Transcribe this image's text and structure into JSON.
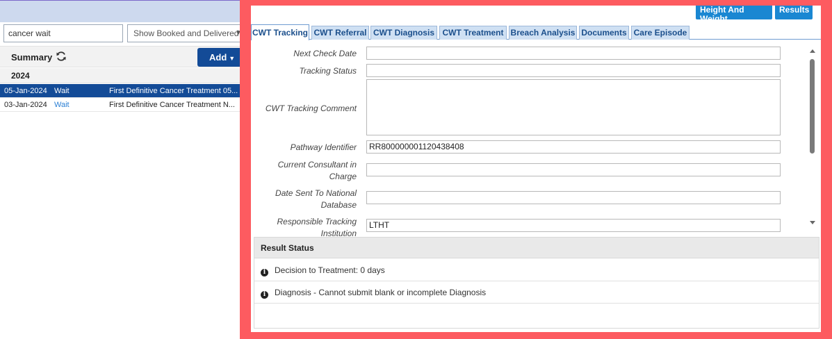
{
  "left_pane": {
    "search": {
      "value": "cancer wait"
    },
    "filter": {
      "value": "Show Booked and Delivered"
    },
    "summary_label": "Summary",
    "add_label": "Add",
    "year": "2024",
    "rows": [
      {
        "date": "05-Jan-2024",
        "type": "Wait",
        "description": "First Definitive Cancer Treatment 05...",
        "selected": true
      },
      {
        "date": "03-Jan-2024",
        "type": "Wait",
        "description": "First Definitive Cancer Treatment N...",
        "selected": false
      }
    ]
  },
  "modal": {
    "top_buttons": {
      "height_weight": "Height And Weight",
      "results": "Results"
    },
    "tabs": [
      "CWT Tracking",
      "CWT Referral",
      "CWT Diagnosis",
      "CWT Treatment",
      "Breach Analysis",
      "Documents",
      "Care Episode"
    ],
    "active_tab": "CWT Tracking",
    "fields": {
      "next_check_date": {
        "label": "Next Check Date",
        "value": ""
      },
      "tracking_status": {
        "label": "Tracking Status",
        "value": ""
      },
      "tracking_comment": {
        "label": "CWT Tracking Comment",
        "value": ""
      },
      "pathway_identifier": {
        "label": "Pathway Identifier",
        "value": "RR800000001120438408"
      },
      "current_consultant_1": "Current Consultant in",
      "current_consultant_2": "Charge",
      "current_consultant_value": "",
      "date_sent_1": "Date Sent To National",
      "date_sent_2": "Database",
      "date_sent_value": "",
      "responsible_1": "Responsible Tracking",
      "responsible_2": "Institution",
      "responsible_value": "LTHT"
    },
    "result_status": {
      "title": "Result Status",
      "messages": [
        "Decision to Treatment: 0 days",
        "Diagnosis - Cannot submit blank or incomplete Diagnosis"
      ]
    }
  },
  "colors": {
    "modal_border": "#fd5b60",
    "selected_row": "#134b97",
    "add_button": "#134b97",
    "tab_background": "#cfe0f3",
    "top_button": "#1a87d2"
  }
}
